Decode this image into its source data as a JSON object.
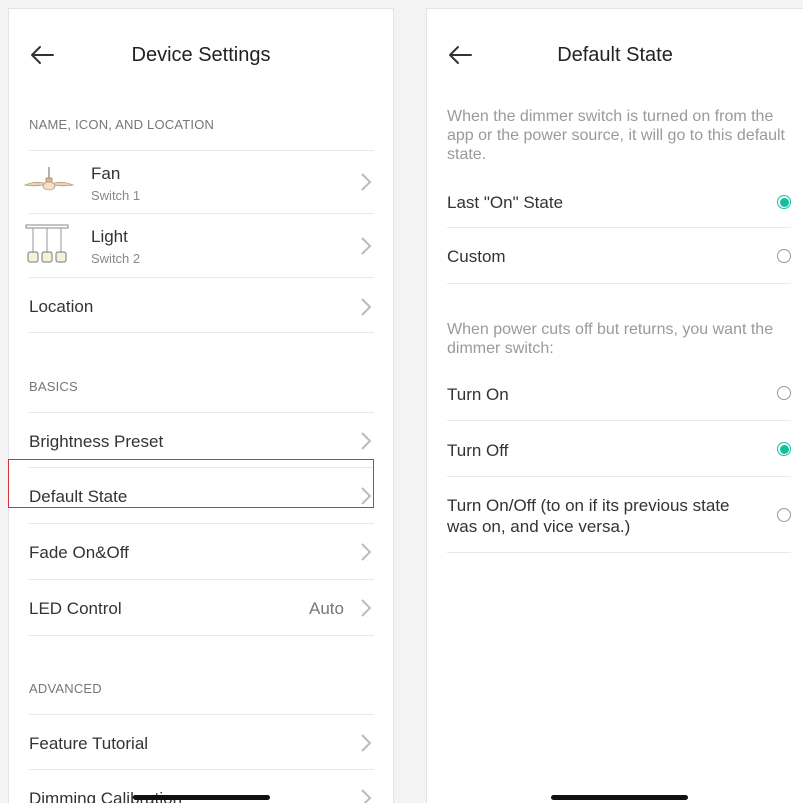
{
  "left": {
    "title": "Device Settings",
    "sections": {
      "name": "NAME, ICON, AND LOCATION",
      "basics": "BASICS",
      "advanced": "ADVANCED"
    },
    "items": {
      "fan": {
        "label": "Fan",
        "sub": "Switch 1"
      },
      "light": {
        "label": "Light",
        "sub": "Switch 2"
      },
      "location": "Location",
      "brightness": "Brightness Preset",
      "default_state": "Default State",
      "fade": "Fade On&Off",
      "led": {
        "label": "LED Control",
        "value": "Auto"
      },
      "tutorial": "Feature Tutorial",
      "dimming": "Dimming Calibration"
    }
  },
  "right": {
    "title": "Default State",
    "desc1": "When the dimmer switch is turned on from the app or the power source, it will go to this default state.",
    "desc2": "When power cuts off but returns, you want the dimmer switch:",
    "options1": [
      {
        "label": "Last \"On\" State",
        "selected": true
      },
      {
        "label": "Custom",
        "selected": false
      }
    ],
    "options2": [
      {
        "label": "Turn On",
        "selected": false
      },
      {
        "label": "Turn Off",
        "selected": true
      },
      {
        "label": "Turn On/Off (to on if its previous state was on, and vice versa.)",
        "selected": false
      }
    ]
  },
  "colors": {
    "accent": "#11bfa0",
    "highlight": "#d6323a"
  }
}
